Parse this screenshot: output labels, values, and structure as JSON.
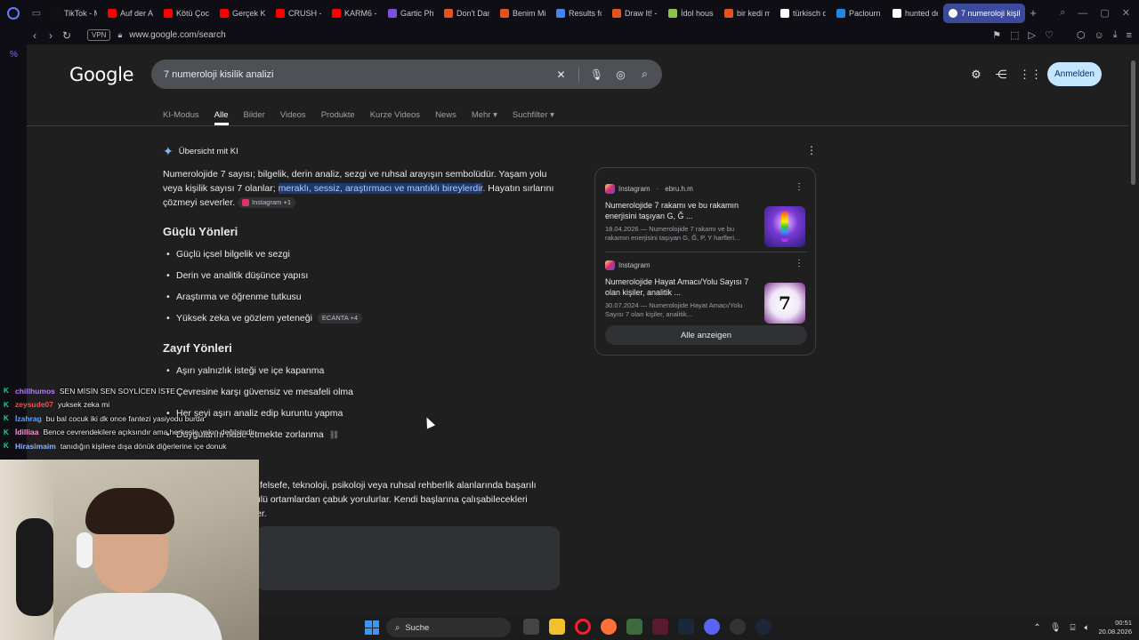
{
  "browser": {
    "tabs": [
      {
        "label": "TikTok - M",
        "color": "#111111"
      },
      {
        "label": "Auf der Au",
        "color": "#ff0000"
      },
      {
        "label": "Kötü Çocu",
        "color": "#ff0000"
      },
      {
        "label": "Gerçek Ke",
        "color": "#ff0000"
      },
      {
        "label": "CRUSH - (",
        "color": "#ff0000"
      },
      {
        "label": "KARM6 -",
        "color": "#ff0000"
      },
      {
        "label": "Gartic Pho",
        "color": "#7b4fe0"
      },
      {
        "label": "Don't Dan",
        "color": "#e2541c"
      },
      {
        "label": "Benim Mir",
        "color": "#e2541c"
      },
      {
        "label": "Results fo",
        "color": "#4285f4"
      },
      {
        "label": "Draw It! -",
        "color": "#e2541c"
      },
      {
        "label": "İdol house",
        "color": "#8bc34a"
      },
      {
        "label": "bir kedi m",
        "color": "#e2541c"
      },
      {
        "label": "türkisch d",
        "color": "#ffffff"
      },
      {
        "label": "Paclourn S",
        "color": "#1e88e5"
      },
      {
        "label": "hunted de",
        "color": "#ffffff"
      }
    ],
    "active_tab": "7 numeroloji kişilik",
    "vpn": "VPN",
    "url": "www.google.com/search",
    "sidebar_mark": "%"
  },
  "google": {
    "logo": "Google",
    "query": "7 numeroloji kisilik analizi",
    "signin": "Anmelden",
    "filters": [
      "KI-Modus",
      "Alle",
      "Bilder",
      "Videos",
      "Produkte",
      "Kurze Videos",
      "News",
      "Mehr ▾",
      "Suchfilter ▾"
    ],
    "active_filter": "Alle"
  },
  "ai": {
    "heading": "Übersicht mit KI",
    "intro_plain": "Numerolojide 7 sayısı; bilgelik, derin analiz, sezgi ve ruhsal arayışın sembolüdür. Yaşam yolu veya kişilik sayısı 7 olanlar; ",
    "intro_highlight": "meraklı, sessiz, araştırmacı ve mantıklı bireylerdir",
    "intro_rest": ". Hayatın sırlarını çözmeyi severler.",
    "intro_chip": "Instagram +1",
    "strengths_title": "Güçlü Yönleri",
    "strengths": [
      "Güçlü içsel bilgelik ve sezgi",
      "Derin ve analitik düşünce yapısı",
      "Araştırma ve öğrenme tutkusu",
      "Yüksek zeka ve gözlem yeteneği"
    ],
    "strengths_chip": "ECANTA +4",
    "weak_title": "Zayıf Yönleri",
    "weak": [
      "Aşırı yalnızlık isteği ve içe kapanma",
      "Çevresine karşı güvensiz ve mesafeli olma",
      "Her şeyi aşırı analiz edip kuruntu yapma",
      "Duygularını ifade etmekte zorlanma"
    ],
    "career_partial": "felsefe, teknoloji, psikoloji veya ruhsal rehberlik alanlarında başarılı",
    "career_partial2": "tülü ortamlardan çabuk yorulurlar. Kendi başlarına çalışabilecekleri",
    "career_partial3": "er."
  },
  "sources": {
    "items": [
      {
        "site": "Instagram",
        "author": "ebru.h.m",
        "title": "Numerolojide 7 rakamı ve bu rakamın enerjisini taşıyan G, Ğ ...",
        "snippet": "18.04.2026 — Numerolojide 7 rakamı ve bu rakamın enerjisini taşıyan G, Ğ, P, Y harfleri..."
      },
      {
        "site": "Instagram",
        "author": "",
        "title": "Numerolojide Hayat Amacı/Yolu Sayısı 7 olan kişiler, analitik ...",
        "snippet": "30.07.2024 — Numerolojide Hayat Amacı/Yolu Sayısı 7 olan kişiler, analitik...",
        "thumb_text": "7"
      }
    ],
    "show_all": "Alle anzeigen"
  },
  "chat": [
    {
      "user": "chillhumos",
      "color": "#b57bff",
      "msg": "SEN MİSİN SEN SOYLİCEN İSTE"
    },
    {
      "user": "zeysude07",
      "color": "#ff4d4d",
      "msg": "yuksek zeka mi"
    },
    {
      "user": "İzahrag",
      "color": "#5aa0ff",
      "msg": "bu bal cocuk iki dk once fantezi yasiyodu burda"
    },
    {
      "user": "İdilliaa",
      "color": "#ff8fd8",
      "msg": "Bence cevrendekilere açıksındır ama herkesle yakın değilsindir"
    },
    {
      "user": "Hirasimaim",
      "color": "#8fb4ff",
      "msg": "tanıdığın kişilere dışa dönük diğerlerine içe donuk"
    }
  ],
  "taskbar": {
    "search": "Suche",
    "time": "00:51",
    "date": "20.08.2026"
  }
}
